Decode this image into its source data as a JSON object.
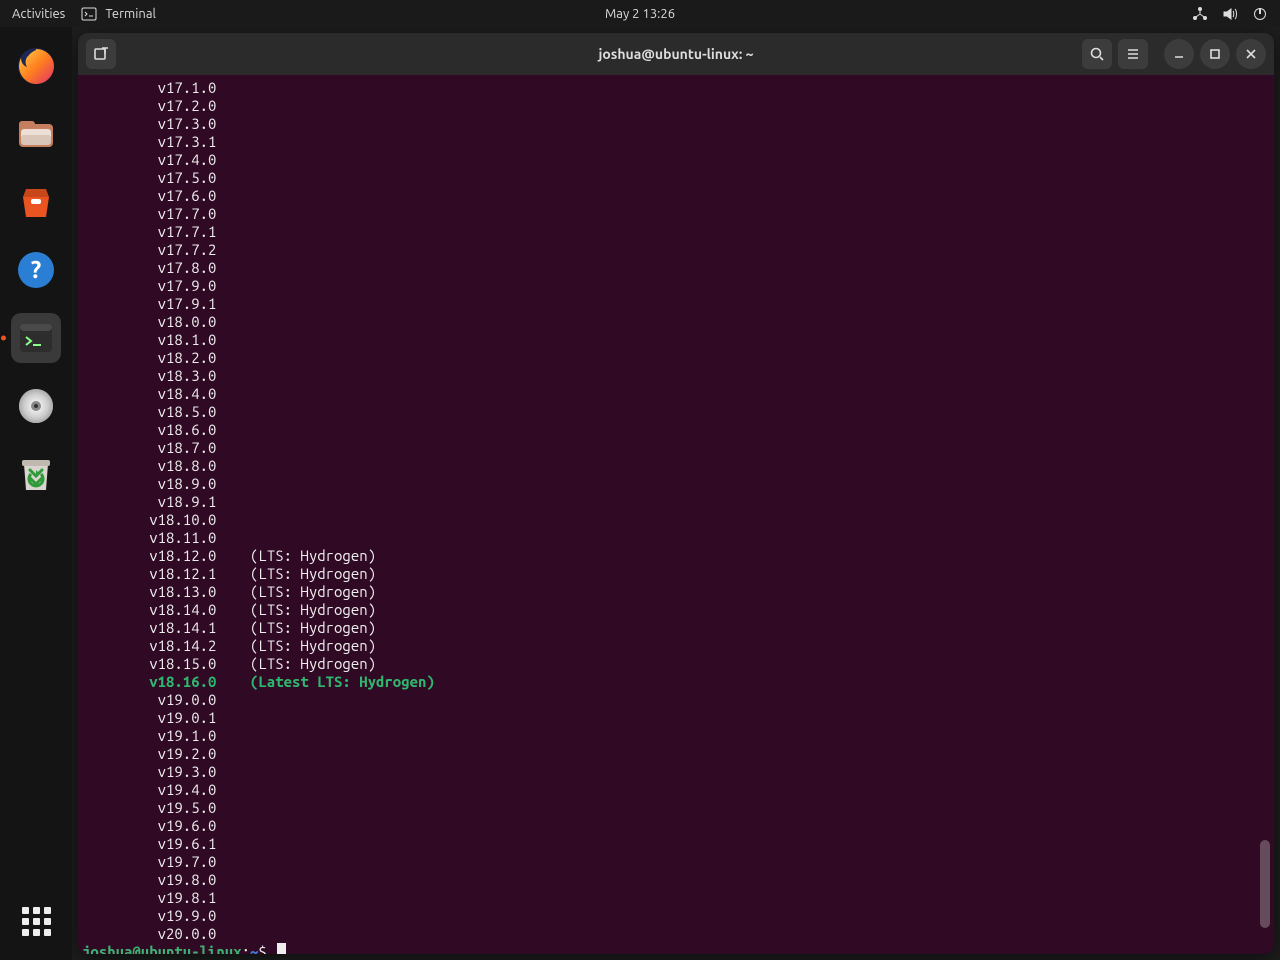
{
  "top": {
    "activities": "Activities",
    "app_name": "Terminal",
    "clock": "May 2  13:26"
  },
  "dock": {
    "items": [
      {
        "name": "firefox-icon"
      },
      {
        "name": "files-icon"
      },
      {
        "name": "software-icon"
      },
      {
        "name": "help-icon"
      },
      {
        "name": "terminal-icon",
        "active": true
      },
      {
        "name": "disc-icon"
      },
      {
        "name": "trash-icon"
      }
    ]
  },
  "terminal": {
    "title": "joshua@ubuntu-linux: ~",
    "prompt": {
      "user_host": "joshua@ubuntu-linux",
      "sep": ":",
      "path": "~",
      "suffix": "$"
    },
    "lines": [
      {
        "v": "v17.1.0"
      },
      {
        "v": "v17.2.0"
      },
      {
        "v": "v17.3.0"
      },
      {
        "v": "v17.3.1"
      },
      {
        "v": "v17.4.0"
      },
      {
        "v": "v17.5.0"
      },
      {
        "v": "v17.6.0"
      },
      {
        "v": "v17.7.0"
      },
      {
        "v": "v17.7.1"
      },
      {
        "v": "v17.7.2"
      },
      {
        "v": "v17.8.0"
      },
      {
        "v": "v17.9.0"
      },
      {
        "v": "v17.9.1"
      },
      {
        "v": "v18.0.0"
      },
      {
        "v": "v18.1.0"
      },
      {
        "v": "v18.2.0"
      },
      {
        "v": "v18.3.0"
      },
      {
        "v": "v18.4.0"
      },
      {
        "v": "v18.5.0"
      },
      {
        "v": "v18.6.0"
      },
      {
        "v": "v18.7.0"
      },
      {
        "v": "v18.8.0"
      },
      {
        "v": "v18.9.0"
      },
      {
        "v": "v18.9.1"
      },
      {
        "v": "v18.10.0"
      },
      {
        "v": "v18.11.0"
      },
      {
        "v": "v18.12.0",
        "tag": "(LTS: Hydrogen)"
      },
      {
        "v": "v18.12.1",
        "tag": "(LTS: Hydrogen)"
      },
      {
        "v": "v18.13.0",
        "tag": "(LTS: Hydrogen)"
      },
      {
        "v": "v18.14.0",
        "tag": "(LTS: Hydrogen)"
      },
      {
        "v": "v18.14.1",
        "tag": "(LTS: Hydrogen)"
      },
      {
        "v": "v18.14.2",
        "tag": "(LTS: Hydrogen)"
      },
      {
        "v": "v18.15.0",
        "tag": "(LTS: Hydrogen)"
      },
      {
        "v": "v18.16.0",
        "tag": "(Latest LTS: Hydrogen)",
        "latest": true
      },
      {
        "v": "v19.0.0"
      },
      {
        "v": "v19.0.1"
      },
      {
        "v": "v19.1.0"
      },
      {
        "v": "v19.2.0"
      },
      {
        "v": "v19.3.0"
      },
      {
        "v": "v19.4.0"
      },
      {
        "v": "v19.5.0"
      },
      {
        "v": "v19.6.0"
      },
      {
        "v": "v19.6.1"
      },
      {
        "v": "v19.7.0"
      },
      {
        "v": "v19.8.0"
      },
      {
        "v": "v19.8.1"
      },
      {
        "v": "v19.9.0"
      },
      {
        "v": "v20.0.0"
      }
    ],
    "scrollbar": {
      "top_frac": 0.87,
      "height_frac": 0.1
    }
  }
}
